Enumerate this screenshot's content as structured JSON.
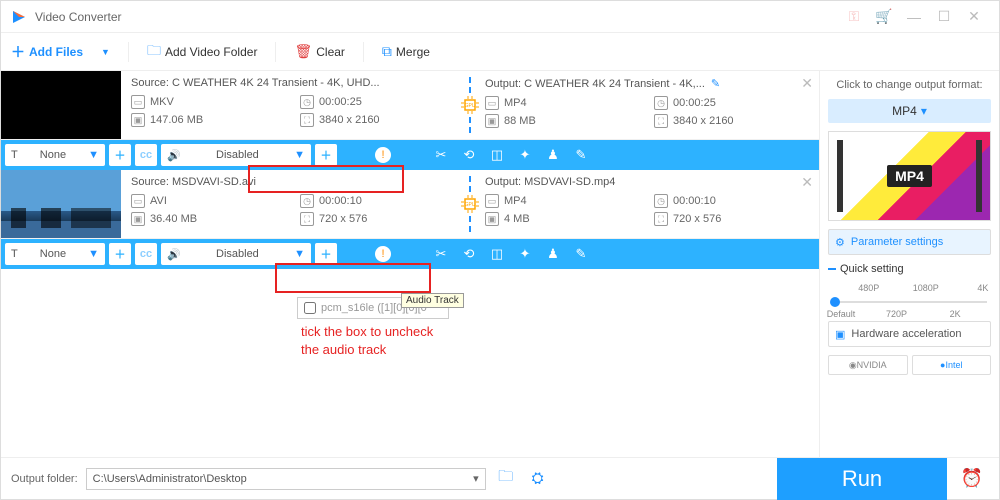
{
  "titlebar": {
    "title": "Video Converter"
  },
  "toolbar": {
    "add_files": "Add Files",
    "add_folder": "Add Video Folder",
    "clear": "Clear",
    "merge": "Merge"
  },
  "items": [
    {
      "source_label": "Source: C  WEATHER  4K 24  Transient - 4K, UHD...",
      "src_format": "MKV",
      "src_duration": "00:00:25",
      "src_size": "147.06 MB",
      "src_res": "3840 x 2160",
      "output_label": "Output: C  WEATHER  4K 24  Transient - 4K,...",
      "out_format": "MP4",
      "out_duration": "00:00:25",
      "out_size": "88 MB",
      "out_res": "3840 x 2160",
      "subtitle": "None",
      "audio": "Disabled"
    },
    {
      "source_label": "Source: MSDVAVI-SD.avi",
      "src_format": "AVI",
      "src_duration": "00:00:10",
      "src_size": "36.40 MB",
      "src_res": "720 x 576",
      "output_label": "Output: MSDVAVI-SD.mp4",
      "out_format": "MP4",
      "out_duration": "00:00:10",
      "out_size": "4 MB",
      "out_res": "720 x 576",
      "subtitle": "None",
      "audio": "Disabled"
    }
  ],
  "audio_dropdown": {
    "option": "pcm_s16le ([1][0][0][0",
    "tooltip": "Audio Track"
  },
  "annotation": {
    "line1": "tick the box to uncheck",
    "line2": "the audio track"
  },
  "side": {
    "title": "Click to change output format:",
    "format_button": "MP4",
    "format_label": "MP4",
    "param_settings": "Parameter settings",
    "quick_setting": "Quick setting",
    "ticks": {
      "t1": "480P",
      "t2": "1080P",
      "t3": "4K",
      "b1": "Default",
      "b2": "720P",
      "b3": "2K"
    },
    "hw_accel": "Hardware acceleration",
    "nvidia": "NVIDIA",
    "intel": "Intel"
  },
  "bottom": {
    "label": "Output folder:",
    "path": "C:\\Users\\Administrator\\Desktop",
    "run": "Run"
  }
}
